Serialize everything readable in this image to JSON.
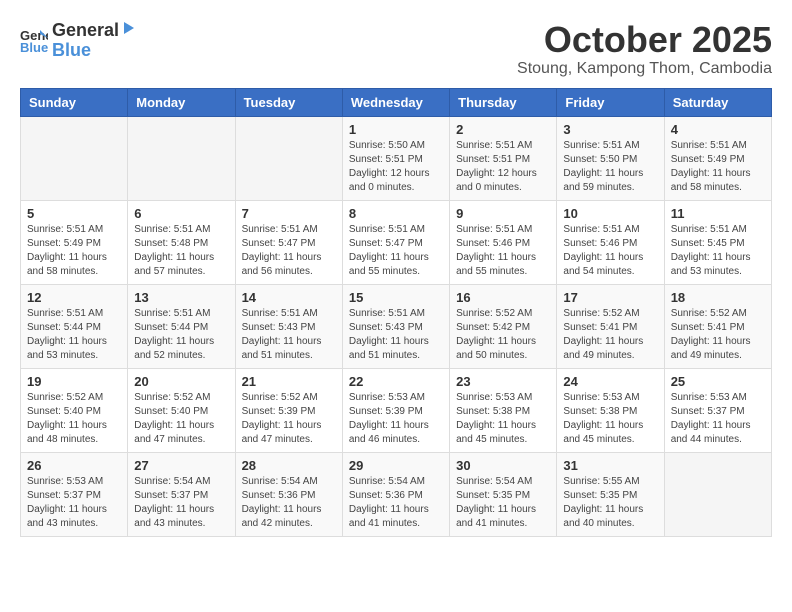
{
  "logo": {
    "general": "General",
    "blue": "Blue"
  },
  "title": "October 2025",
  "location": "Stoung, Kampong Thom, Cambodia",
  "days_header": [
    "Sunday",
    "Monday",
    "Tuesday",
    "Wednesday",
    "Thursday",
    "Friday",
    "Saturday"
  ],
  "weeks": [
    [
      {
        "day": "",
        "info": ""
      },
      {
        "day": "",
        "info": ""
      },
      {
        "day": "",
        "info": ""
      },
      {
        "day": "1",
        "info": "Sunrise: 5:50 AM\nSunset: 5:51 PM\nDaylight: 12 hours\nand 0 minutes."
      },
      {
        "day": "2",
        "info": "Sunrise: 5:51 AM\nSunset: 5:51 PM\nDaylight: 12 hours\nand 0 minutes."
      },
      {
        "day": "3",
        "info": "Sunrise: 5:51 AM\nSunset: 5:50 PM\nDaylight: 11 hours\nand 59 minutes."
      },
      {
        "day": "4",
        "info": "Sunrise: 5:51 AM\nSunset: 5:49 PM\nDaylight: 11 hours\nand 58 minutes."
      }
    ],
    [
      {
        "day": "5",
        "info": "Sunrise: 5:51 AM\nSunset: 5:49 PM\nDaylight: 11 hours\nand 58 minutes."
      },
      {
        "day": "6",
        "info": "Sunrise: 5:51 AM\nSunset: 5:48 PM\nDaylight: 11 hours\nand 57 minutes."
      },
      {
        "day": "7",
        "info": "Sunrise: 5:51 AM\nSunset: 5:47 PM\nDaylight: 11 hours\nand 56 minutes."
      },
      {
        "day": "8",
        "info": "Sunrise: 5:51 AM\nSunset: 5:47 PM\nDaylight: 11 hours\nand 55 minutes."
      },
      {
        "day": "9",
        "info": "Sunrise: 5:51 AM\nSunset: 5:46 PM\nDaylight: 11 hours\nand 55 minutes."
      },
      {
        "day": "10",
        "info": "Sunrise: 5:51 AM\nSunset: 5:46 PM\nDaylight: 11 hours\nand 54 minutes."
      },
      {
        "day": "11",
        "info": "Sunrise: 5:51 AM\nSunset: 5:45 PM\nDaylight: 11 hours\nand 53 minutes."
      }
    ],
    [
      {
        "day": "12",
        "info": "Sunrise: 5:51 AM\nSunset: 5:44 PM\nDaylight: 11 hours\nand 53 minutes."
      },
      {
        "day": "13",
        "info": "Sunrise: 5:51 AM\nSunset: 5:44 PM\nDaylight: 11 hours\nand 52 minutes."
      },
      {
        "day": "14",
        "info": "Sunrise: 5:51 AM\nSunset: 5:43 PM\nDaylight: 11 hours\nand 51 minutes."
      },
      {
        "day": "15",
        "info": "Sunrise: 5:51 AM\nSunset: 5:43 PM\nDaylight: 11 hours\nand 51 minutes."
      },
      {
        "day": "16",
        "info": "Sunrise: 5:52 AM\nSunset: 5:42 PM\nDaylight: 11 hours\nand 50 minutes."
      },
      {
        "day": "17",
        "info": "Sunrise: 5:52 AM\nSunset: 5:41 PM\nDaylight: 11 hours\nand 49 minutes."
      },
      {
        "day": "18",
        "info": "Sunrise: 5:52 AM\nSunset: 5:41 PM\nDaylight: 11 hours\nand 49 minutes."
      }
    ],
    [
      {
        "day": "19",
        "info": "Sunrise: 5:52 AM\nSunset: 5:40 PM\nDaylight: 11 hours\nand 48 minutes."
      },
      {
        "day": "20",
        "info": "Sunrise: 5:52 AM\nSunset: 5:40 PM\nDaylight: 11 hours\nand 47 minutes."
      },
      {
        "day": "21",
        "info": "Sunrise: 5:52 AM\nSunset: 5:39 PM\nDaylight: 11 hours\nand 47 minutes."
      },
      {
        "day": "22",
        "info": "Sunrise: 5:53 AM\nSunset: 5:39 PM\nDaylight: 11 hours\nand 46 minutes."
      },
      {
        "day": "23",
        "info": "Sunrise: 5:53 AM\nSunset: 5:38 PM\nDaylight: 11 hours\nand 45 minutes."
      },
      {
        "day": "24",
        "info": "Sunrise: 5:53 AM\nSunset: 5:38 PM\nDaylight: 11 hours\nand 45 minutes."
      },
      {
        "day": "25",
        "info": "Sunrise: 5:53 AM\nSunset: 5:37 PM\nDaylight: 11 hours\nand 44 minutes."
      }
    ],
    [
      {
        "day": "26",
        "info": "Sunrise: 5:53 AM\nSunset: 5:37 PM\nDaylight: 11 hours\nand 43 minutes."
      },
      {
        "day": "27",
        "info": "Sunrise: 5:54 AM\nSunset: 5:37 PM\nDaylight: 11 hours\nand 43 minutes."
      },
      {
        "day": "28",
        "info": "Sunrise: 5:54 AM\nSunset: 5:36 PM\nDaylight: 11 hours\nand 42 minutes."
      },
      {
        "day": "29",
        "info": "Sunrise: 5:54 AM\nSunset: 5:36 PM\nDaylight: 11 hours\nand 41 minutes."
      },
      {
        "day": "30",
        "info": "Sunrise: 5:54 AM\nSunset: 5:35 PM\nDaylight: 11 hours\nand 41 minutes."
      },
      {
        "day": "31",
        "info": "Sunrise: 5:55 AM\nSunset: 5:35 PM\nDaylight: 11 hours\nand 40 minutes."
      },
      {
        "day": "",
        "info": ""
      }
    ]
  ]
}
